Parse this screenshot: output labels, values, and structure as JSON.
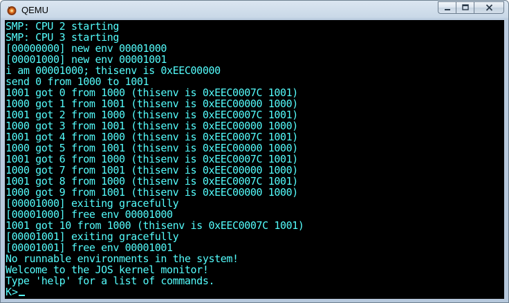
{
  "window": {
    "title": "QEMU",
    "icon": "qemu-app-icon",
    "controls": [
      "minimize-icon",
      "maximize-icon",
      "close-icon"
    ]
  },
  "terminal": {
    "fg_color": "#54fcfc",
    "bg_color": "#000000",
    "lines": [
      "SMP: CPU 2 starting",
      "SMP: CPU 3 starting",
      "[00000000] new env 00001000",
      "[00001000] new env 00001001",
      "i am 00001000; thisenv is 0xEEC00000",
      "send 0 from 1000 to 1001",
      "1001 got 0 from 1000 (thisenv is 0xEEC0007C 1001)",
      "1000 got 1 from 1001 (thisenv is 0xEEC00000 1000)",
      "1001 got 2 from 1000 (thisenv is 0xEEC0007C 1001)",
      "1000 got 3 from 1001 (thisenv is 0xEEC00000 1000)",
      "1001 got 4 from 1000 (thisenv is 0xEEC0007C 1001)",
      "1000 got 5 from 1001 (thisenv is 0xEEC00000 1000)",
      "1001 got 6 from 1000 (thisenv is 0xEEC0007C 1001)",
      "1000 got 7 from 1001 (thisenv is 0xEEC00000 1000)",
      "1001 got 8 from 1000 (thisenv is 0xEEC0007C 1001)",
      "1000 got 9 from 1001 (thisenv is 0xEEC00000 1000)",
      "[00001000] exiting gracefully",
      "[00001000] free env 00001000",
      "1001 got 10 from 1000 (thisenv is 0xEEC0007C 1001)",
      "[00001001] exiting gracefully",
      "[00001001] free env 00001001",
      "No runnable environments in the system!",
      "Welcome to the JOS kernel monitor!",
      "Type 'help' for a list of commands."
    ],
    "prompt": "K>"
  }
}
